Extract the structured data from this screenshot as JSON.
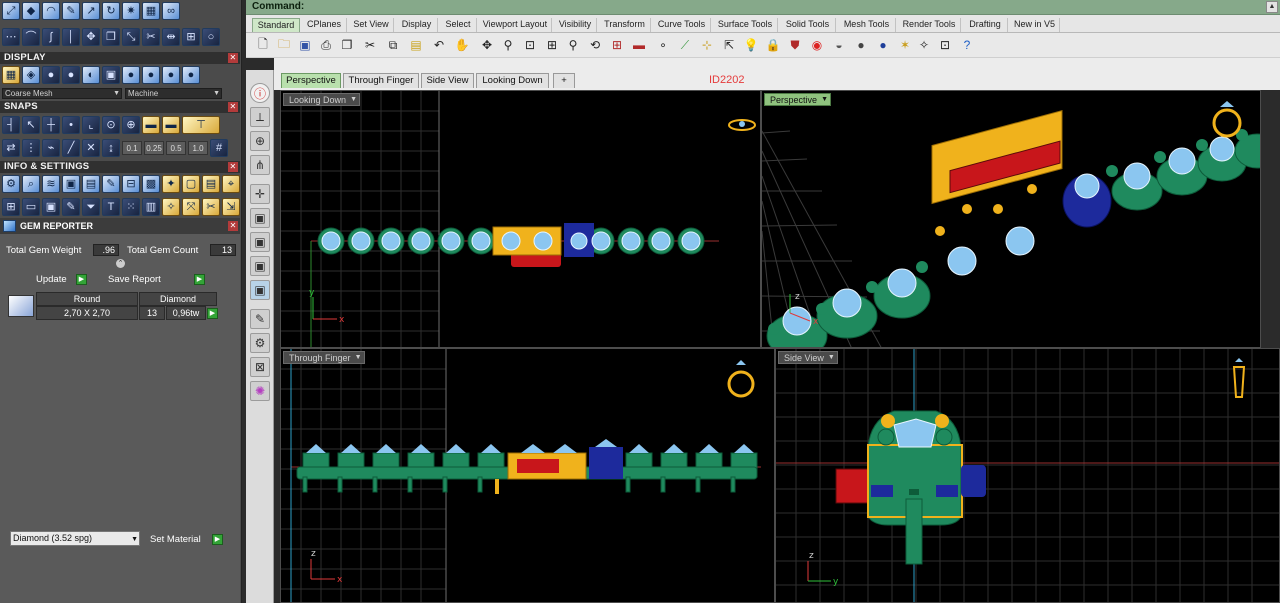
{
  "command": {
    "label": "Command:"
  },
  "toolbar_tabs": [
    "Standard",
    "CPlanes",
    "Set View",
    "Display",
    "Select",
    "Viewport Layout",
    "Visibility",
    "Transform",
    "Curve Tools",
    "Surface Tools",
    "Solid Tools",
    "Mesh Tools",
    "Render Tools",
    "Drafting",
    "New in V5"
  ],
  "viewport_tabs": [
    "Perspective",
    "Through Finger",
    "Side View",
    "Looking Down"
  ],
  "viewport_tab_add": "+",
  "id_tag": "ID2202",
  "viewports": {
    "top_left": {
      "title": "Looking Down"
    },
    "top_right": {
      "title": "Perspective"
    },
    "bottom_left": {
      "title": "Through Finger"
    },
    "bottom_right": {
      "title": "Side View"
    }
  },
  "left_panel": {
    "display": {
      "title": "DISPLAY",
      "mesh_select": "Coarse Mesh",
      "material_select": "Machine"
    },
    "snaps": {
      "title": "SNAPS",
      "values": [
        "0.1",
        "0.25",
        "0.5",
        "1.0"
      ]
    },
    "info_settings": {
      "title": "INFO & SETTINGS"
    },
    "gem_reporter": {
      "title": "GEM REPORTER",
      "total_gem_weight_label": "Total Gem Weight",
      "total_gem_weight_value": ".96",
      "total_gem_count_label": "Total Gem Count",
      "total_gem_count_value": "13",
      "update_label": "Update",
      "save_report_label": "Save Report",
      "table": {
        "headers": [
          "Round",
          "Diamond"
        ],
        "row": {
          "size": "2,70 X 2,70",
          "count": "13",
          "weight": "0,96tw"
        }
      },
      "material_select": "Diamond    (3.52 spg)",
      "set_material_label": "Set Material"
    }
  },
  "colors": {
    "command_bar": "#86a98a",
    "active_tab": "#cfe7c8",
    "highlight_viewport": "#8fc27e",
    "gem_green": "#1f8a5e",
    "gem_blue": "#8bc6f0",
    "gold": "#f0b21c",
    "sapphire": "#1d2a9c",
    "ruby": "#c8161b"
  }
}
